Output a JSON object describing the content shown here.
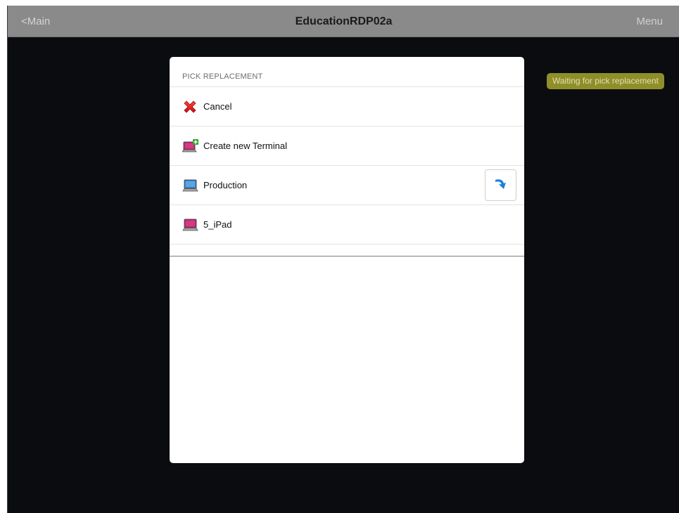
{
  "navbar": {
    "back_label": "<Main",
    "title": "EducationRDP02a",
    "menu_label": "Menu"
  },
  "status": {
    "text": "Waiting for pick replacement"
  },
  "popover": {
    "header": "PICK REPLACEMENT",
    "items": [
      {
        "label": "Cancel",
        "icon": "cancel-x-icon"
      },
      {
        "label": "Create new Terminal",
        "icon": "add-terminal-icon"
      },
      {
        "label": "Production",
        "icon": "terminal-blue-icon",
        "has_detail_button": true,
        "detail_icon": "curved-arrow-down-icon"
      },
      {
        "label": "5_iPad",
        "icon": "terminal-magenta-icon"
      }
    ]
  },
  "colors": {
    "navbar": "#8a8a8a",
    "background": "#0b0c0f",
    "status_pill": "#8f8f2a",
    "accent_blue": "#1b7fe0"
  }
}
